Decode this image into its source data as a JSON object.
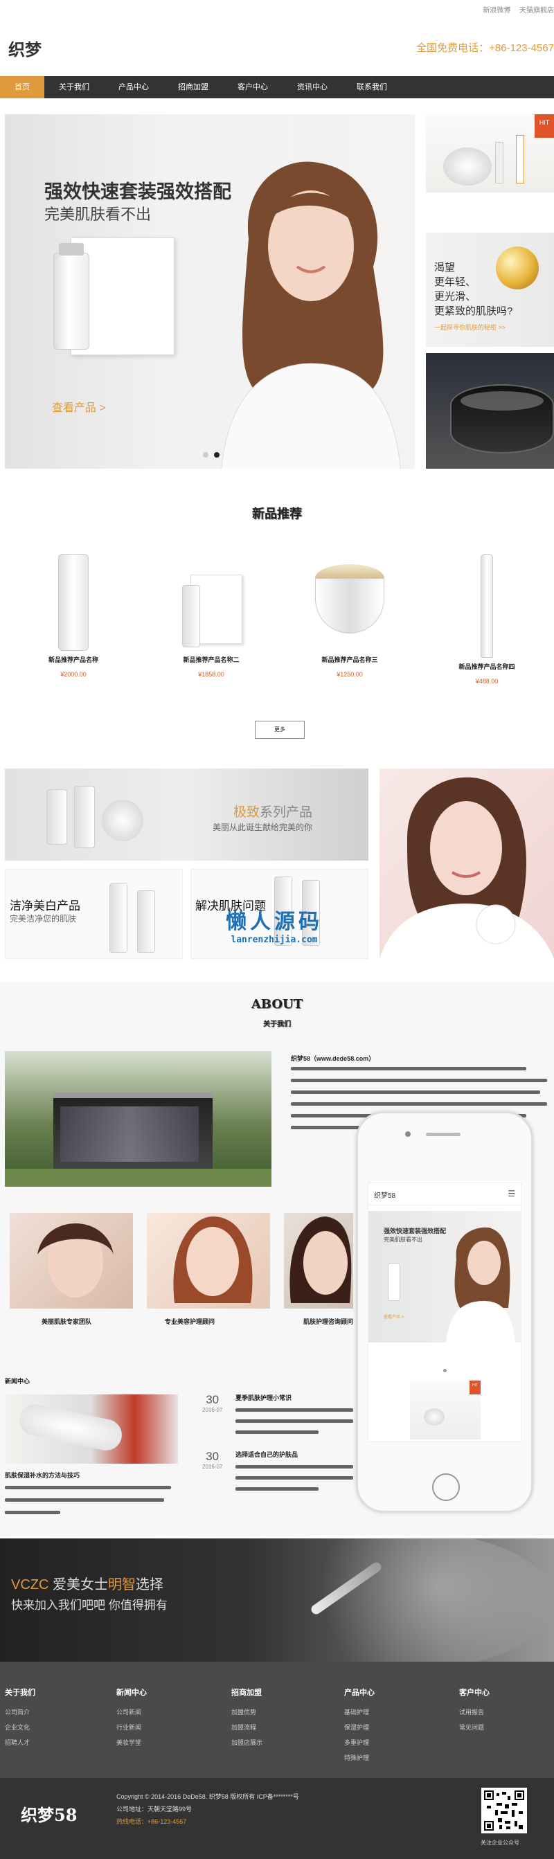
{
  "header": {
    "top_links": [
      "新浪微博",
      "天猫旗舰店"
    ],
    "logo": "织梦",
    "hotline": "全国免费电话：+86-123-4567"
  },
  "nav": {
    "items": [
      "首页",
      "关于我们",
      "产品中心",
      "招商加盟",
      "客户中心",
      "资讯中心",
      "联系我们"
    ],
    "active": "首页"
  },
  "hero": {
    "title": "强效快速套装强效搭配",
    "subtitle": "完美肌肤看不出",
    "cta": "查看产品 >"
  },
  "side_banners": {
    "hit_badge": "HIT",
    "promo_lines": [
      "渴望",
      "更年轻、",
      "更光滑、",
      "更紧致的肌肤吗?"
    ],
    "promo_small": "一起探寻你肌肤的秘密 >>"
  },
  "products": {
    "title": "新品推荐",
    "items": [
      {
        "name": "新品推荐产品名称",
        "price": "¥2000.00"
      },
      {
        "name": "新品推荐产品名称二",
        "price": "¥1858.00"
      },
      {
        "name": "新品推荐产品名称三",
        "price": "¥1250.00"
      },
      {
        "name": "新品推荐产品名称四",
        "price": "¥488.00"
      }
    ],
    "more_label": "更多"
  },
  "banners": {
    "series_title_accent": "极致",
    "series_title_rest": "系列产品",
    "series_sub": "美丽从此诞生献给完美的你",
    "clean_title": "洁净美白产品",
    "clean_sub": "完美洁净您的肌肤",
    "solve_title": "解决肌肤问题",
    "watermark_cn": "懒人源码",
    "watermark_url": "lanrenzhijia.com"
  },
  "about": {
    "title": "ABOUT",
    "subtitle": "关于我们",
    "intro": "织梦58（www.dede58.com）",
    "team_captions": [
      "美丽肌肤专家团队",
      "专业美容护理顾问",
      "肌肤护理咨询顾问"
    ],
    "news_label": "新闻中心",
    "news": [
      {
        "day": "30",
        "month": "2016-07",
        "title": "夏季肌肤护理小常识"
      },
      {
        "day": "30",
        "month": "2016-07",
        "title": "选择适合自己的护肤品"
      }
    ],
    "news_feature_title": "肌肤保湿补水的方法与技巧"
  },
  "phone": {
    "logo": "织梦58",
    "title": "强效快速套装强效搭配",
    "subtitle": "完美肌肤看不出",
    "cta": "查看产品 >",
    "hit": "HIT"
  },
  "promo": {
    "brand": "VCZC",
    "line1_mid": " 爱美女士",
    "line1_accent": "明智",
    "line1_end": "选择",
    "line2": "快来加入我们吧吧 你值得拥有"
  },
  "footer": {
    "columns": [
      {
        "title": "关于我们",
        "links": [
          "公司简介",
          "企业文化",
          "招聘人才"
        ]
      },
      {
        "title": "新闻中心",
        "links": [
          "公司新闻",
          "行业新闻",
          "美妆学堂"
        ]
      },
      {
        "title": "招商加盟",
        "links": [
          "加盟优势",
          "加盟流程",
          "加盟店展示"
        ]
      },
      {
        "title": "产品中心",
        "links": [
          "基础护理",
          "保湿护理",
          "多重护理",
          "特殊护理"
        ]
      },
      {
        "title": "客户中心",
        "links": [
          "试用报告",
          "常见问题"
        ]
      }
    ],
    "logo": "织梦58",
    "copyright": "Copyright © 2014-2016 DeDe58. 织梦58 版权所有 ICP备********号",
    "address": "公司地址：天朝天堂路99号",
    "hotline": "热线电话：+86-123-4567",
    "qr_caption": "关注企业公众号"
  },
  "colors": {
    "accent": "#e09a3b",
    "nav": "#333333",
    "footer": "#4a4a4a"
  }
}
